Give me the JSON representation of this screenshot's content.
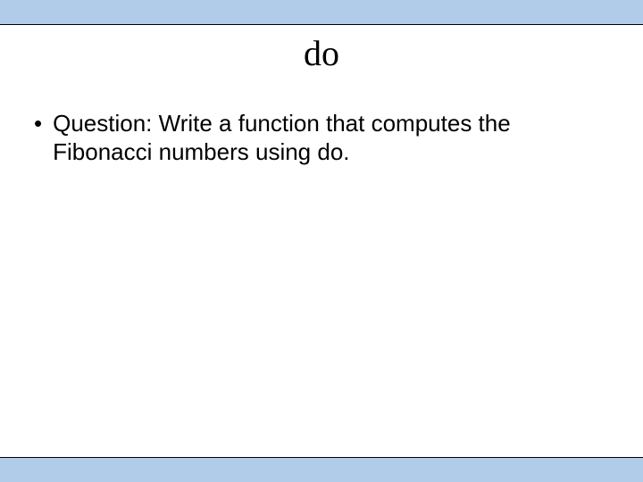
{
  "slide": {
    "title": "do",
    "bullet": "•",
    "body": "Question:  Write a function that computes the Fibonacci numbers using do."
  }
}
